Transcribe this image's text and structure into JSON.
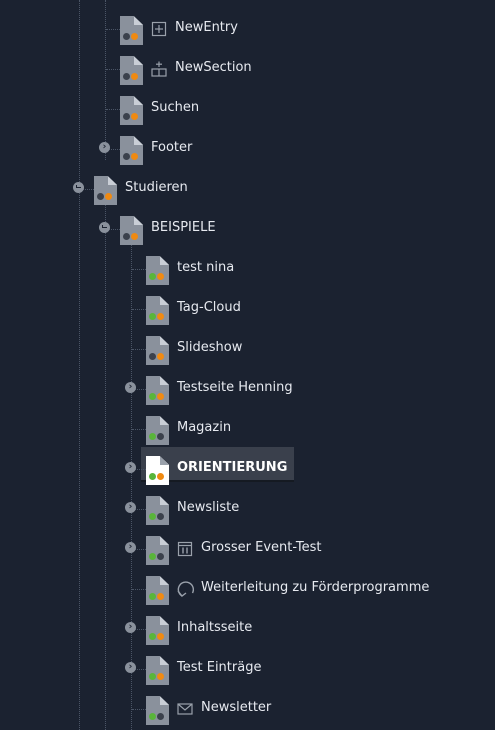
{
  "colors": {
    "background": "#1b2230",
    "selected_background": "#3a404c",
    "status_orange": "#f08a12",
    "status_green": "#59b53a",
    "status_grey": "#3b414c"
  },
  "tree": {
    "new_entry": {
      "label": "NewEntry",
      "type_icon": "plus-box-icon"
    },
    "new_section": {
      "label": "NewSection",
      "type_icon": "section-add-icon"
    },
    "suchen": {
      "label": "Suchen"
    },
    "footer": {
      "label": "Footer"
    },
    "studieren": {
      "label": "Studieren"
    },
    "beispiele": {
      "label": "BEISPIELE"
    },
    "test_nina": {
      "label": "test nina"
    },
    "tag_cloud": {
      "label": "Tag-Cloud"
    },
    "slideshow": {
      "label": "Slideshow"
    },
    "testseite_henning": {
      "label": "Testseite Henning"
    },
    "magazin": {
      "label": "Magazin"
    },
    "orientierung": {
      "label": "ORIENTIERUNG"
    },
    "newsliste": {
      "label": "Newsliste"
    },
    "grosser_event_test": {
      "label": "Grosser Event-Test",
      "type_icon": "calendar-icon"
    },
    "weiterleitung": {
      "label": "Weiterleitung zu Förderprogramme",
      "type_icon": "redirect-icon"
    },
    "inhaltsseite": {
      "label": "Inhaltsseite"
    },
    "test_eintraege": {
      "label": "Test Einträge"
    },
    "newsletter": {
      "label": "Newsletter",
      "type_icon": "envelope-icon"
    }
  }
}
